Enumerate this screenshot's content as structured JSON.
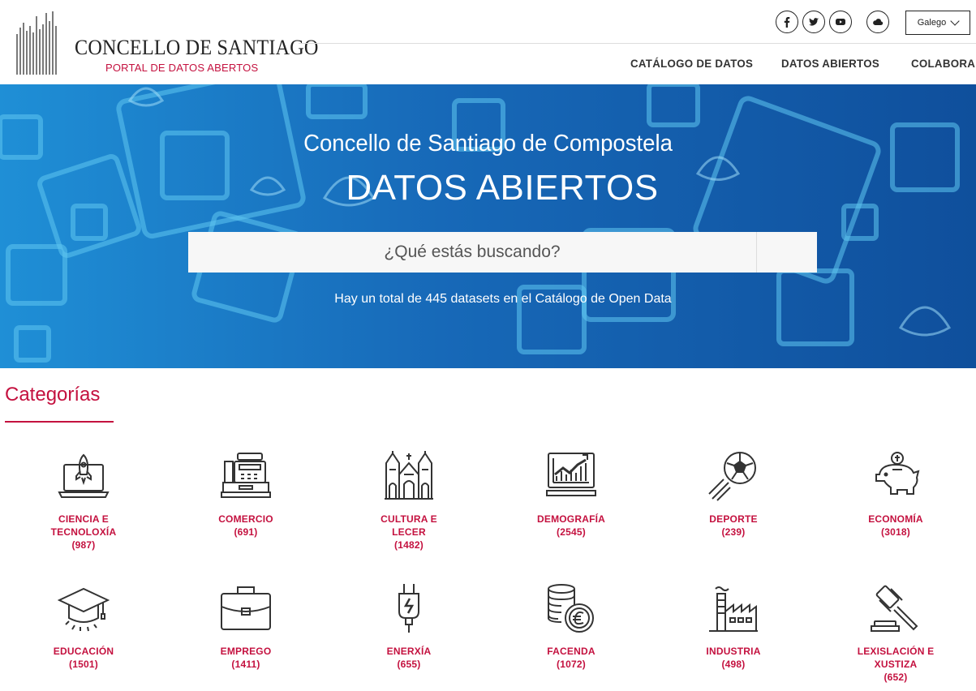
{
  "header": {
    "logo_title": "CONCELLO DE SANTIAGO",
    "logo_subtitle": "PORTAL DE DATOS ABERTOS",
    "social": [
      {
        "icon": "facebook-icon"
      },
      {
        "icon": "twitter-icon"
      },
      {
        "icon": "youtube-icon"
      },
      {
        "icon": "cloud-icon"
      }
    ],
    "language": "Galego",
    "nav": [
      "CATÁLOGO DE DATOS",
      "DATOS ABIERTOS",
      "COLABORA"
    ]
  },
  "hero": {
    "subtitle": "Concello de Santiago de Compostela",
    "title": "DATOS ABIERTOS",
    "search_placeholder": "¿Qué estás buscando?",
    "note": "Hay un total de 445 datasets en el Catálogo de Open Data"
  },
  "categories": {
    "heading": "Categorías",
    "items": [
      {
        "lines": [
          "CIENCIA E",
          "TECNOLOXÍA",
          "(987)"
        ],
        "icon": "rocket-laptop-icon"
      },
      {
        "lines": [
          "COMERCIO",
          "(691)"
        ],
        "icon": "cash-register-icon"
      },
      {
        "lines": [
          "CULTURA E",
          "LECER",
          "(1482)"
        ],
        "icon": "cathedral-icon"
      },
      {
        "lines": [
          "DEMOGRAFÍA",
          "(2545)"
        ],
        "icon": "chart-monitor-icon"
      },
      {
        "lines": [
          "DEPORTE",
          "(239)"
        ],
        "icon": "soccer-ball-icon"
      },
      {
        "lines": [
          "ECONOMÍA",
          "(3018)"
        ],
        "icon": "piggy-bank-icon"
      },
      {
        "lines": [
          "EDUCACIÓN",
          "(1501)"
        ],
        "icon": "graduation-cap-icon"
      },
      {
        "lines": [
          "EMPREGO",
          "(1411)"
        ],
        "icon": "briefcase-icon"
      },
      {
        "lines": [
          "ENERXÍA",
          "(655)"
        ],
        "icon": "plug-icon"
      },
      {
        "lines": [
          "FACENDA",
          "(1072)"
        ],
        "icon": "coins-euro-icon"
      },
      {
        "lines": [
          "INDUSTRIA",
          "(498)"
        ],
        "icon": "factory-icon"
      },
      {
        "lines": [
          "LEXISLACIÓN E",
          "XUSTIZA",
          "(652)"
        ],
        "icon": "gavel-icon"
      }
    ]
  }
}
